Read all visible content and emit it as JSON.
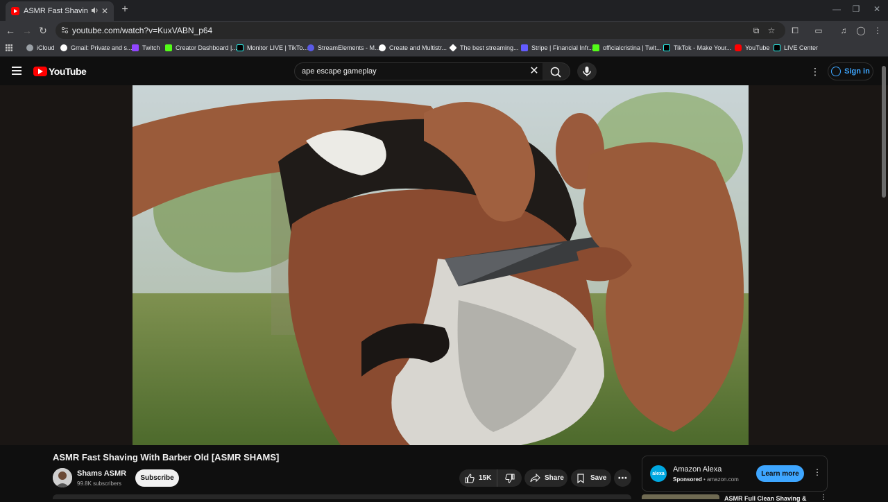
{
  "browser": {
    "tab_title": "ASMR Fast Shaving With Ba",
    "url": "youtube.com/watch?v=KuxVABN_p64",
    "bookmarks": [
      {
        "label": "iCloud",
        "color": "#9aa0a6"
      },
      {
        "label": "Gmail: Private and s...",
        "color": "#ffffff"
      },
      {
        "label": "Twitch",
        "color": "#9146ff"
      },
      {
        "label": "Creator Dashboard |...",
        "color": "#53fc18"
      },
      {
        "label": "Monitor LIVE | TikTo...",
        "color": "#000000"
      },
      {
        "label": "StreamElements - M...",
        "color": "#5a5ae6"
      },
      {
        "label": "Create and Multistr...",
        "color": "#1e1e1e"
      },
      {
        "label": "The best streaming...",
        "color": "#ffffff"
      },
      {
        "label": "Stripe | Financial Infr...",
        "color": "#635bff"
      },
      {
        "label": "officialcristina | Twit...",
        "color": "#53fc18"
      },
      {
        "label": "TikTok - Make Your...",
        "color": "#000000"
      },
      {
        "label": "YouTube",
        "color": "#ff0000"
      },
      {
        "label": "LIVE Center",
        "color": "#000000"
      }
    ]
  },
  "youtube": {
    "logo_text": "YouTube",
    "search_value": "ape escape gameplay",
    "sign_in": "Sign in"
  },
  "video": {
    "title": "ASMR Fast Shaving With Barber Old [ASMR SHAMS]",
    "channel": "Shams ASMR",
    "subscribers": "99.8K subscribers",
    "subscribe": "Subscribe",
    "likes": "15K",
    "share": "Share",
    "save": "Save"
  },
  "ad": {
    "logo": "alexa",
    "name": "Amazon Alexa",
    "sponsored": "Sponsored",
    "domain": " • amazon.com",
    "cta": "Learn more"
  },
  "recommendation": {
    "title": "ASMR Full Clean Shaving &"
  },
  "colors": {
    "accent": "#3ea6ff",
    "brand": "#ff0000",
    "bg": "#0f0f0f"
  }
}
